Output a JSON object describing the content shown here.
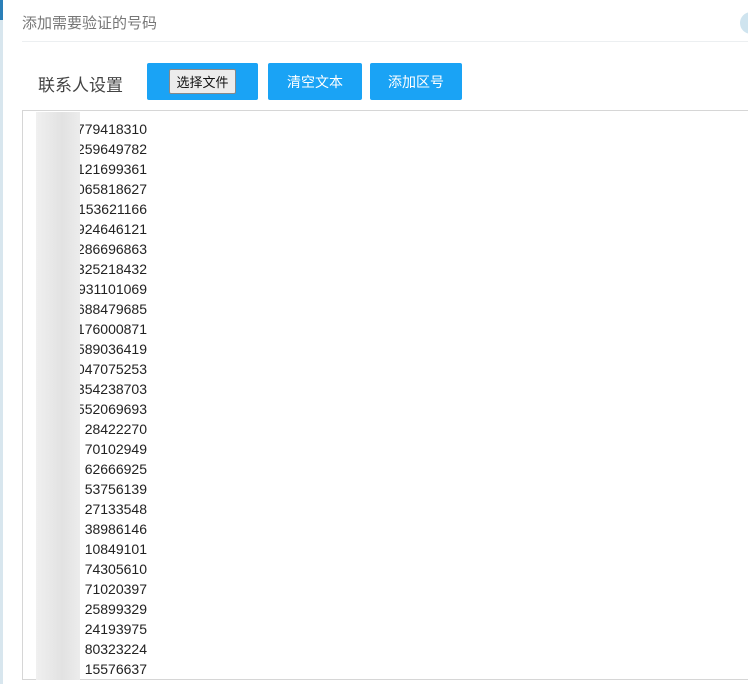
{
  "dialog": {
    "title": "添加需要验证的号码"
  },
  "toolbar": {
    "label": "联系人设置",
    "choose_file_label": "选择文件",
    "clear_text_label": "清空文本",
    "add_area_code_label": "添加区号"
  },
  "numbers": [
    "779418310",
    "259649782",
    "121699361",
    "065818627",
    "153621166",
    "924646121",
    "286696863",
    "325218432",
    "931101069",
    "688479685",
    "176000871",
    "589036419",
    "047075253",
    "354238703",
    "552069693",
    "28422270",
    "70102949",
    "62666925",
    "53756139",
    "27133548",
    "38986146",
    "10849101",
    "74305610",
    "71020397",
    "25899329",
    "24193975",
    "80323224",
    "15576637"
  ]
}
